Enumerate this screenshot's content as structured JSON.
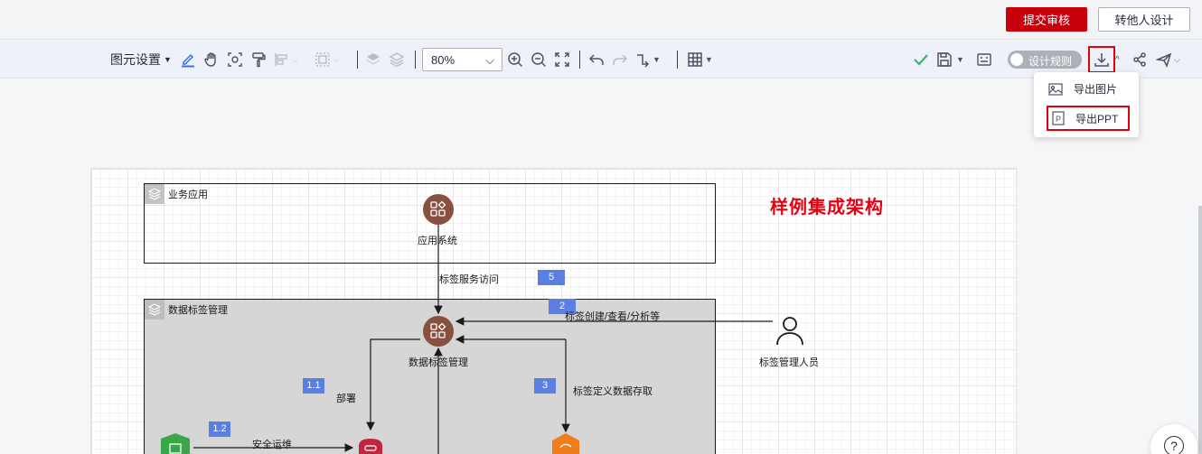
{
  "header": {
    "submit_label": "提交审核",
    "transfer_label": "转他人设计"
  },
  "toolbar": {
    "shape_settings": "图元设置",
    "zoom": "80%",
    "design_rules": "设计规则",
    "icons": [
      "pen-icon",
      "hand-icon",
      "focus-icon",
      "format-painter-icon",
      "align-icon",
      "frame-icon",
      "layer-up-icon",
      "layer-down-icon",
      "zoom-in-icon",
      "zoom-out-icon",
      "fit-screen-icon",
      "undo-icon",
      "redo-icon",
      "connector-icon",
      "table-icon",
      "check-icon",
      "save-icon",
      "preview-icon",
      "download-icon",
      "share-icon",
      "send-icon"
    ]
  },
  "export_menu": {
    "items": [
      {
        "label": "导出图片",
        "icon": "image-icon"
      },
      {
        "label": "导出PPT",
        "icon": "ppt-icon"
      }
    ]
  },
  "diagram": {
    "title": "样例集成架构",
    "layers": [
      {
        "title": "业务应用"
      },
      {
        "title": "数据标签管理"
      }
    ],
    "nodes": {
      "app_system": "应用系统",
      "tag_management": "数据标签管理",
      "tag_manager_person": "标签管理人员"
    },
    "flows": [
      {
        "badge": "5",
        "label": "标签服务访问"
      },
      {
        "badge": "2",
        "label": "标签创建/查看/分析等"
      },
      {
        "badge": "1.1",
        "label": "部署"
      },
      {
        "badge": "3",
        "label": "标签定义数据存取"
      },
      {
        "badge": "1.2",
        "label": "安全运维"
      }
    ]
  },
  "help_label": "?"
}
